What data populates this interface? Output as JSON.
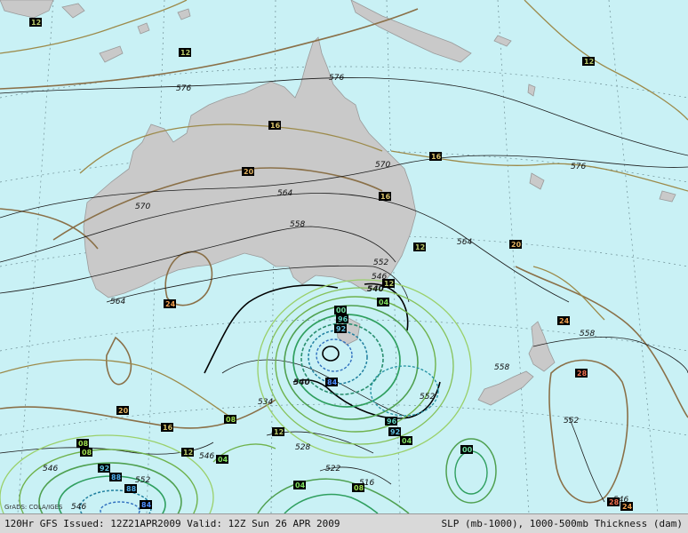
{
  "footer": {
    "left_text": "120Hr GFS Issued: 12Z21APR2009 Valid: 12Z Sun 26 APR 2009",
    "right_text": "SLP (mb-1000), 1000-500mb Thickness (dam)"
  },
  "credit": "GrADS: COLA/IGES",
  "colors": {
    "ocean": "#c9f1f5",
    "land": "#c9c9c9",
    "thickness_line": "#1a1a1a",
    "slp_high": "#8a7048",
    "slp_low_outer": "#7fbf3f",
    "slp_low_mid": "#2f9f5f",
    "slp_low_inner": "#1f7f9f",
    "footer_bg": "#d9d9d9"
  },
  "thickness_labels": {
    "t576a": "576",
    "t576b": "576",
    "t576c": "576",
    "t570a": "570",
    "t570b": "570",
    "t564a": "564",
    "t564b": "564",
    "t564c": "564",
    "t558a": "558",
    "t558b": "558",
    "t558c": "558",
    "t552a": "552",
    "t552b": "552",
    "t552c": "552",
    "t552d": "552",
    "t546a": "546",
    "t546b": "546",
    "t546c": "546",
    "t546d": "546",
    "t546e": "546",
    "t540a": "540",
    "t540b": "540",
    "t534": "534",
    "t528": "528",
    "t522": "522",
    "t516": "516"
  },
  "slp_labels": {
    "p12a": "12",
    "p12b": "12",
    "p12c": "12",
    "p12d": "12",
    "p12e": "12",
    "p12f": "12",
    "p12g": "12",
    "p16a": "16",
    "p16b": "16",
    "p16c": "16",
    "p16d": "16",
    "p20a": "20",
    "p20b": "20",
    "p20c": "20",
    "p24a": "24",
    "p24b": "24",
    "p24c": "24",
    "p28a": "28",
    "p28b": "28",
    "p04a": "04",
    "p04b": "04",
    "p04c": "04",
    "p04d": "04",
    "p08a": "08",
    "p08b": "08",
    "p08c": "08",
    "p08d": "08",
    "p00a": "00",
    "p00b": "00",
    "p96a": "96",
    "p96b": "96",
    "p92a": "92",
    "p92b": "92",
    "p92c": "92",
    "p88a": "88",
    "p88b": "88",
    "p84a": "84",
    "p84b": "84"
  }
}
